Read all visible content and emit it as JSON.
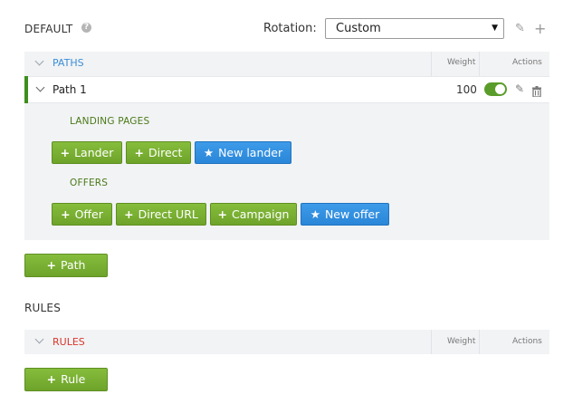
{
  "default_section": {
    "title": "DEFAULT",
    "help_icon": "question-circle-icon",
    "rotation_label": "Rotation:",
    "rotation_value": "Custom"
  },
  "paths_table": {
    "header_label": "PATHS",
    "weight_header": "Weight",
    "actions_header": "Actions",
    "rows": [
      {
        "name": "Path 1",
        "weight": "100",
        "enabled": true
      }
    ],
    "landing_pages": {
      "label": "LANDING PAGES",
      "buttons": [
        "Lander",
        "Direct",
        "New lander"
      ]
    },
    "offers": {
      "label": "OFFERS",
      "buttons": [
        "Offer",
        "Direct URL",
        "Campaign",
        "New offer"
      ]
    }
  },
  "add_path_label": "Path",
  "rules_section": {
    "title": "RULES",
    "header_label": "RULES",
    "weight_header": "Weight",
    "actions_header": "Actions",
    "add_rule_label": "Rule"
  },
  "colors": {
    "green_button": "#6ea32a",
    "blue_button": "#2a86d8",
    "paths_label": "#3a8ed8",
    "rules_label": "#d9372b",
    "accent_bar": "#3c8f1d"
  }
}
